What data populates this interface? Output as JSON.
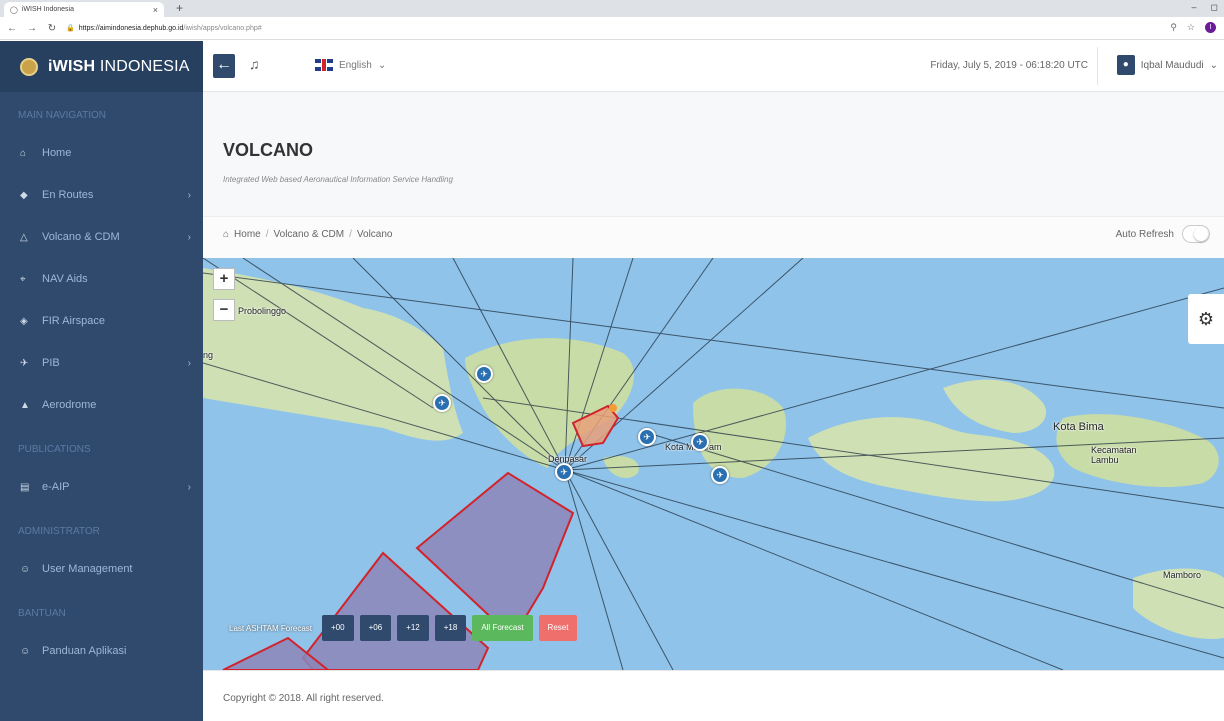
{
  "browser": {
    "tab_title": "iWISH Indonesia",
    "url_host": "https://aimindonesia.dephub.go.id",
    "url_path": "/iwish/apps/volcano.php#",
    "profile_initial": "I"
  },
  "brand": {
    "bold": "iWISH",
    "rest": " INDONESIA"
  },
  "sidebar": {
    "sections": [
      {
        "header": "MAIN NAVIGATION",
        "items": [
          {
            "label": "Home",
            "icon": "home-icon",
            "glyph": "⌂",
            "has_children": false
          },
          {
            "label": "En Routes",
            "icon": "diamond-icon",
            "glyph": "◆",
            "has_children": true
          },
          {
            "label": "Volcano & CDM",
            "icon": "triangle-icon",
            "glyph": "△",
            "has_children": true
          },
          {
            "label": "NAV Aids",
            "icon": "location-pin-icon",
            "glyph": "⌖",
            "has_children": false
          },
          {
            "label": "FIR Airspace",
            "icon": "layers-icon",
            "glyph": "◈",
            "has_children": false
          },
          {
            "label": "PIB",
            "icon": "plane-icon",
            "glyph": "✈",
            "has_children": true
          },
          {
            "label": "Aerodrome",
            "icon": "aerodrome-icon",
            "glyph": "▲",
            "has_children": false
          }
        ]
      },
      {
        "header": "PUBLICATIONS",
        "items": [
          {
            "label": "e-AIP",
            "icon": "document-icon",
            "glyph": "▤",
            "has_children": true
          }
        ]
      },
      {
        "header": "ADMINISTRATOR",
        "items": [
          {
            "label": "User Management",
            "icon": "user-icon",
            "glyph": "☺",
            "has_children": false
          }
        ]
      },
      {
        "header": "BANTUAN",
        "items": [
          {
            "label": "Panduan Aplikasi",
            "icon": "user-icon",
            "glyph": "☺",
            "has_children": false
          }
        ]
      }
    ]
  },
  "topnav": {
    "language": "English",
    "datetime": "Friday, July 5, 2019 - 06:18:20 UTC",
    "user_name": "Iqbal Maududi"
  },
  "page": {
    "title": "VOLCANO",
    "subtitle": "Integrated Web based Aeronautical Information Service Handling",
    "breadcrumb": [
      "Home",
      "Volcano & CDM",
      "Volcano"
    ],
    "auto_refresh_label": "Auto Refresh",
    "auto_refresh_on": false
  },
  "map": {
    "zoom_in": "+",
    "zoom_out": "−",
    "places": [
      "Probolinggo",
      "ng",
      "Denpasar",
      "Kota Mataram",
      "Kota Bima",
      "Kecamatan Lambu",
      "Mamboro"
    ],
    "forecast_label": "Last ASHTAM Forecast",
    "forecast_buttons": [
      "+00",
      "+06",
      "+12",
      "+18"
    ],
    "all_forecast": "All Forecast",
    "reset": "Reset",
    "colors": {
      "sea": "#8fc3ea",
      "land": "#cfe0b4",
      "warning_zone": "#d2232a",
      "volcano_area": "#e8a07a"
    }
  },
  "footer": {
    "copyright": "Copyright © 2018. All right reserved."
  }
}
